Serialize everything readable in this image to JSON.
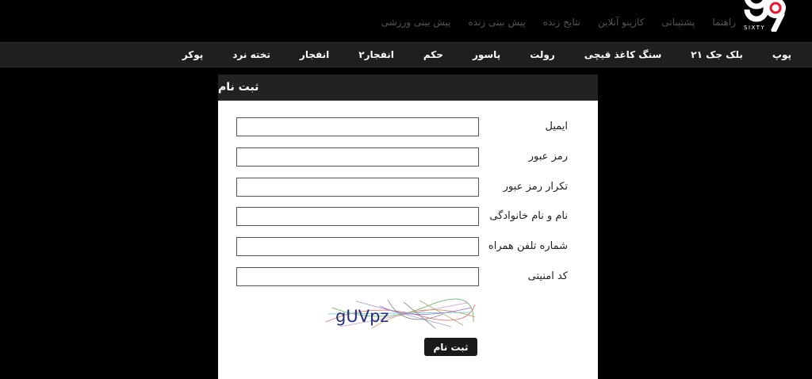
{
  "logo": {
    "text": "SIXTY"
  },
  "top_links": [
    "پیش بینی ورزشی",
    "پیش بینی زنده",
    "نتایج زنده",
    "کازینو آنلاین",
    "پشتیبانی",
    "راهنما"
  ],
  "main_nav": [
    "پوکر",
    "تخته نرد",
    "انفجار",
    "انفجار۲",
    "حکم",
    "پاسور",
    "رولت",
    "سنگ کاغذ قیچی",
    "بلک جک ۲۱",
    "پوپ"
  ],
  "form": {
    "title": "ثبت نام",
    "fields": [
      {
        "label": "ایمیل",
        "value": ""
      },
      {
        "label": "رمز عبور",
        "value": ""
      },
      {
        "label": "تکرار رمز عبور",
        "value": ""
      },
      {
        "label": "نام و نام خانوادگی",
        "value": ""
      },
      {
        "label": "شماره تلفن همراه",
        "value": ""
      },
      {
        "label": "کد امنیتی",
        "value": ""
      }
    ],
    "captcha_text": "gUVpz",
    "submit_label": "ثبت نام"
  },
  "colors": {
    "background": "#000000",
    "nav_bar": "#1f1f1f",
    "logo_accent": "#e8192c"
  }
}
